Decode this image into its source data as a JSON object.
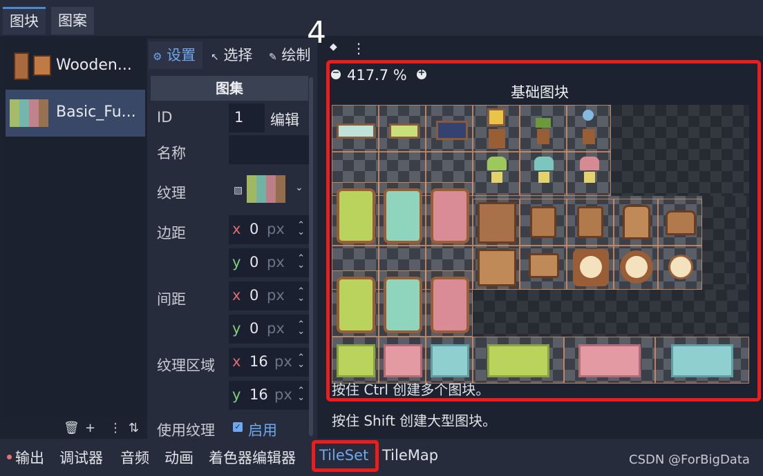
{
  "top_tabs": [
    "图块",
    "图案"
  ],
  "list": {
    "items": [
      {
        "label": "Wooden..."
      },
      {
        "label": "Basic_Fu..."
      }
    ],
    "toolbar_icons": [
      "trash-icon",
      "add-icon",
      "kebab-icon",
      "sort-icon"
    ]
  },
  "modes": {
    "settings": "设置",
    "select": "选择",
    "paint": "绘制"
  },
  "step_number": "4",
  "props": {
    "section": "图集",
    "id_label": "ID",
    "id_value": "1",
    "edit_button": "编辑",
    "name_label": "名称",
    "texture_label": "纹理",
    "margin_label": "边距",
    "spacing_label": "间距",
    "region_label": "纹理区域",
    "use_texture_label": "使用纹理",
    "enabled_label": "启用",
    "margin": {
      "x": "0",
      "y": "0"
    },
    "spacing": {
      "x": "0",
      "y": "0"
    },
    "region": {
      "x": "16",
      "y": "16"
    },
    "unit": "px",
    "x_axis": "x",
    "y_axis": "y"
  },
  "atlas": {
    "zoom": "417.7 %",
    "title": "基础图块",
    "hint_ctrl": "按住 Ctrl 创建多个图块。",
    "hint_shift": "按住 Shift 创建大型图块。"
  },
  "bottom": {
    "tabs": [
      "输出",
      "调试器",
      "音频",
      "动画",
      "着色器编辑器",
      "TileSet",
      "TileMap"
    ],
    "watermark": "CSDN @ForBigData"
  },
  "colors": {
    "accent": "#6fa8ee",
    "highlight": "#ee1c1c"
  }
}
